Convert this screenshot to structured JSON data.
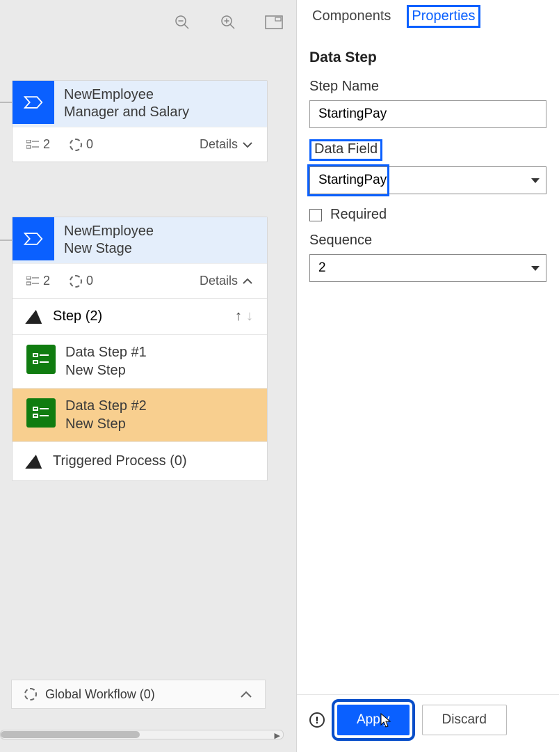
{
  "toolbar": {
    "zoom_out_icon": "zoom-out",
    "zoom_in_icon": "zoom-in",
    "fit_icon": "fit-to-screen"
  },
  "canvas": {
    "stages": [
      {
        "title_line1": "NewEmployee",
        "title_line2": "Manager and Salary",
        "steps_count": "2",
        "open_count": "0",
        "details_label": "Details",
        "expanded": false
      },
      {
        "title_line1": "NewEmployee",
        "title_line2": "New Stage",
        "steps_count": "2",
        "open_count": "0",
        "details_label": "Details",
        "expanded": true,
        "step_header": "Step (2)",
        "steps": [
          {
            "title": "Data Step #1",
            "subtitle": "New Step",
            "selected": false
          },
          {
            "title": "Data Step #2",
            "subtitle": "New Step",
            "selected": true
          }
        ],
        "triggered_label": "Triggered Process (0)"
      }
    ],
    "global_workflow_label": "Global Workflow (0)"
  },
  "panel": {
    "tabs": {
      "components": "Components",
      "properties": "Properties"
    },
    "heading": "Data Step",
    "step_name_label": "Step Name",
    "step_name_value": "StartingPay",
    "data_field_label": "Data Field",
    "data_field_value": "StartingPay",
    "required_label": "Required",
    "sequence_label": "Sequence",
    "sequence_value": "2",
    "apply_label": "Apply",
    "discard_label": "Discard"
  }
}
